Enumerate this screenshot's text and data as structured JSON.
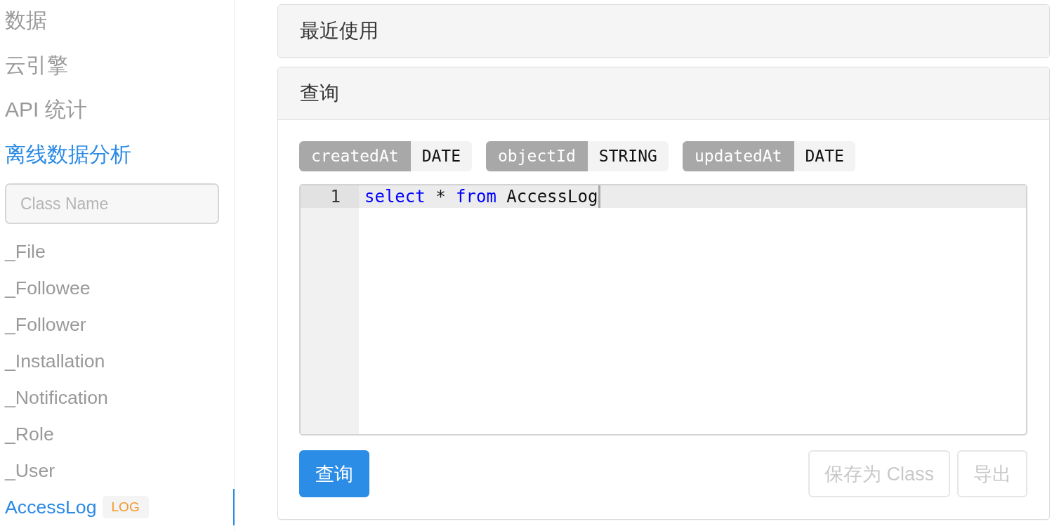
{
  "sidebar": {
    "nav": [
      {
        "label": "数据",
        "selected": false
      },
      {
        "label": "云引擎",
        "selected": false
      },
      {
        "label": "API 统计",
        "selected": false
      },
      {
        "label": "离线数据分析",
        "selected": true
      }
    ],
    "search": {
      "placeholder": "Class Name"
    },
    "classes": [
      {
        "name": "_File",
        "selected": false
      },
      {
        "name": "_Followee",
        "selected": false
      },
      {
        "name": "_Follower",
        "selected": false
      },
      {
        "name": "_Installation",
        "selected": false
      },
      {
        "name": "_Notification",
        "selected": false
      },
      {
        "name": "_Role",
        "selected": false
      },
      {
        "name": "_User",
        "selected": false
      },
      {
        "name": "AccessLog",
        "selected": true,
        "badge": "LOG"
      }
    ]
  },
  "recent_panel": {
    "title": "最近使用"
  },
  "query_panel": {
    "title": "查询",
    "fields": [
      {
        "name": "createdAt",
        "type": "DATE"
      },
      {
        "name": "objectId",
        "type": "STRING"
      },
      {
        "name": "updatedAt",
        "type": "DATE"
      }
    ],
    "editor": {
      "lines": [
        {
          "number": "1",
          "active": true,
          "tokens": [
            {
              "text": "select",
              "kind": "keyword"
            },
            {
              "text": " * ",
              "kind": "plain"
            },
            {
              "text": "from",
              "kind": "keyword"
            },
            {
              "text": " AccessLog",
              "kind": "plain"
            }
          ]
        }
      ]
    },
    "buttons": [
      {
        "label": "查询",
        "kind": "primary",
        "disabled": false
      },
      {
        "label": "保存为 Class",
        "kind": "default",
        "disabled": true
      },
      {
        "label": "导出",
        "kind": "default",
        "disabled": true
      }
    ]
  }
}
